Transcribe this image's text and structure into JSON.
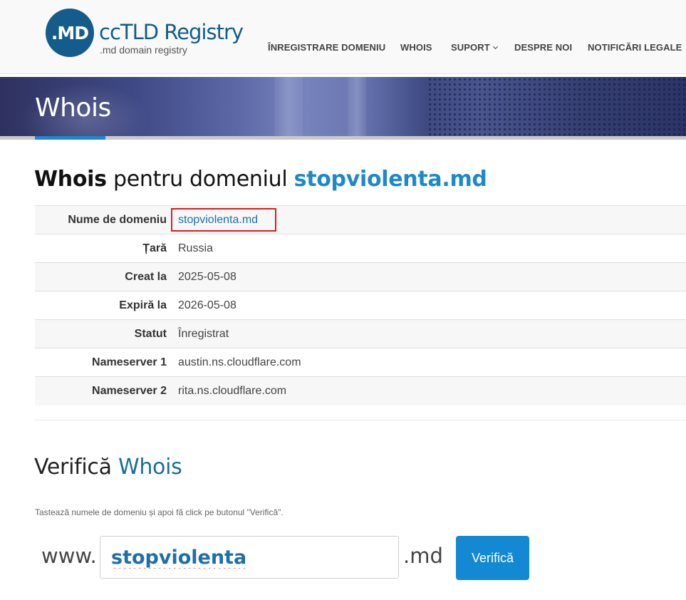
{
  "header": {
    "logo_mark": ".MD",
    "logo_title": "ccTLD Registry",
    "logo_subtitle": ".md domain registry",
    "nav": [
      {
        "label": "ÎNREGISTRARE DOMENIU"
      },
      {
        "label": "WHOIS"
      },
      {
        "label": "SUPORT",
        "has_dropdown": true
      },
      {
        "label": "DESPRE NOI"
      },
      {
        "label": "NOTIFICĂRI LEGALE"
      }
    ]
  },
  "banner": {
    "title": "Whois"
  },
  "result": {
    "heading_bold": "Whois",
    "heading_text": "pentru domeniul",
    "heading_domain": "stopviolenta.md",
    "rows": [
      {
        "label": "Nume de domeniu",
        "value": "stopviolenta.md"
      },
      {
        "label": "Țară",
        "value": "Russia"
      },
      {
        "label": "Creat la",
        "value": "2025-05-08"
      },
      {
        "label": "Expiră la",
        "value": "2026-05-08"
      },
      {
        "label": "Statut",
        "value": "Înregistrat"
      },
      {
        "label": "Nameserver 1",
        "value": "austin.ns.cloudflare.com"
      },
      {
        "label": "Nameserver 2",
        "value": "rita.ns.cloudflare.com"
      }
    ]
  },
  "check": {
    "title": "Verifică",
    "title_accent": "Whois",
    "instruction": "Tastează numele de domeniu și apoi fă click pe butonul \"Verifică\".",
    "prefix": "www.",
    "input_value": "stopviolenta",
    "suffix": ".md",
    "button_label": "Verifică"
  },
  "colors": {
    "brand": "#145c8b",
    "accent": "#1e89c9",
    "button": "#1389d3",
    "highlight": "#d42020"
  }
}
